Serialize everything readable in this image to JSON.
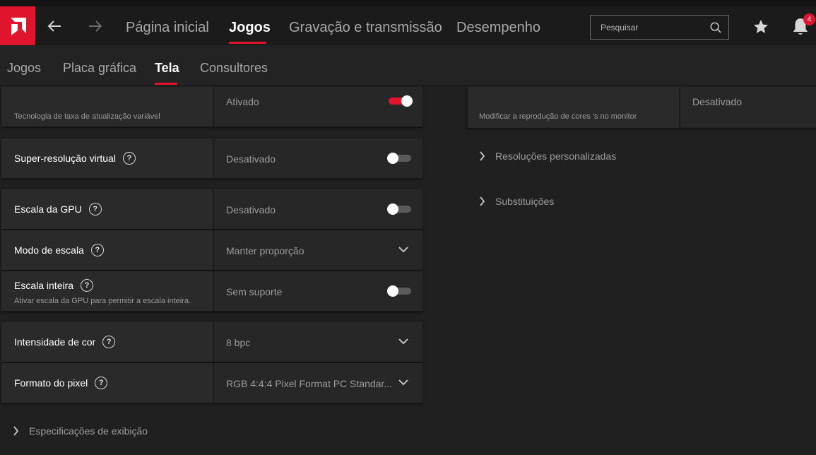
{
  "top_nav": {
    "tabs": [
      {
        "label": "Página inicial"
      },
      {
        "label": "Jogos"
      },
      {
        "label": "Gravação e transmissão"
      },
      {
        "label": "Desempenho"
      }
    ],
    "active_tab": "Jogos",
    "search_placeholder": "Pesquisar",
    "notification_count": "4"
  },
  "sub_nav": {
    "tabs": [
      {
        "label": "Jogos"
      },
      {
        "label": "Placa gráfica"
      },
      {
        "label": "Tela"
      },
      {
        "label": "Consultores"
      }
    ],
    "active_tab": "Tela"
  },
  "left_settings": {
    "freesync": {
      "description": "Tecnologia de taxa de atualização variável",
      "value": "Ativado",
      "toggle_on": true
    },
    "vsr": {
      "label": "Super-resolução virtual",
      "value": "Desativado",
      "toggle_on": false
    },
    "gpu_scaling": {
      "label": "Escala da GPU",
      "value": "Desativado",
      "toggle_on": false
    },
    "scaling_mode": {
      "label": "Modo de escala",
      "value": "Manter proporção"
    },
    "integer_scaling": {
      "label": "Escala inteira",
      "description": "Ativar escala da GPU para permitir a escala inteira.",
      "value": "Sem suporte",
      "toggle_on": false
    },
    "color_depth": {
      "label": "Intensidade de cor",
      "value": "8 bpc"
    },
    "pixel_format": {
      "label": "Formato do pixel",
      "value": "RGB 4:4:4 Pixel Format PC Standar..."
    },
    "display_specs": "Especificações de exibição"
  },
  "right_settings": {
    "color_override": {
      "description": "Modificar a reprodução de cores 's no monitor",
      "value": "Desativado"
    },
    "custom_resolutions": "Resoluções personalizadas",
    "overrides": "Substituições"
  },
  "colors": {
    "accent": "#e0142d",
    "background": "#202020",
    "card": "#2a2a2a"
  }
}
